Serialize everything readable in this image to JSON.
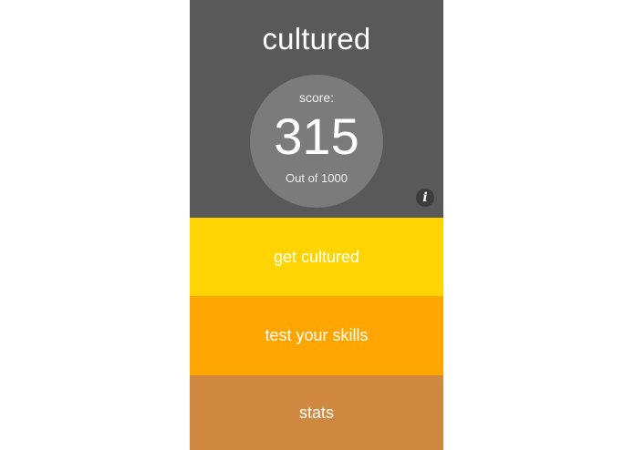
{
  "app": {
    "title": "cultured"
  },
  "score": {
    "label": "score:",
    "value": "315",
    "out_of": "Out of 1000"
  },
  "info_button": {
    "glyph": "i",
    "icon": "info-icon"
  },
  "menu": {
    "get_cultured": {
      "label": "get cultured",
      "color": "#ffd400"
    },
    "test_skills": {
      "label": "test your skills",
      "color": "#ffa500"
    },
    "stats": {
      "label": "stats",
      "color": "#d08840"
    }
  },
  "colors": {
    "header_bg": "#595959",
    "circle_bg": "#7b7b7b"
  }
}
